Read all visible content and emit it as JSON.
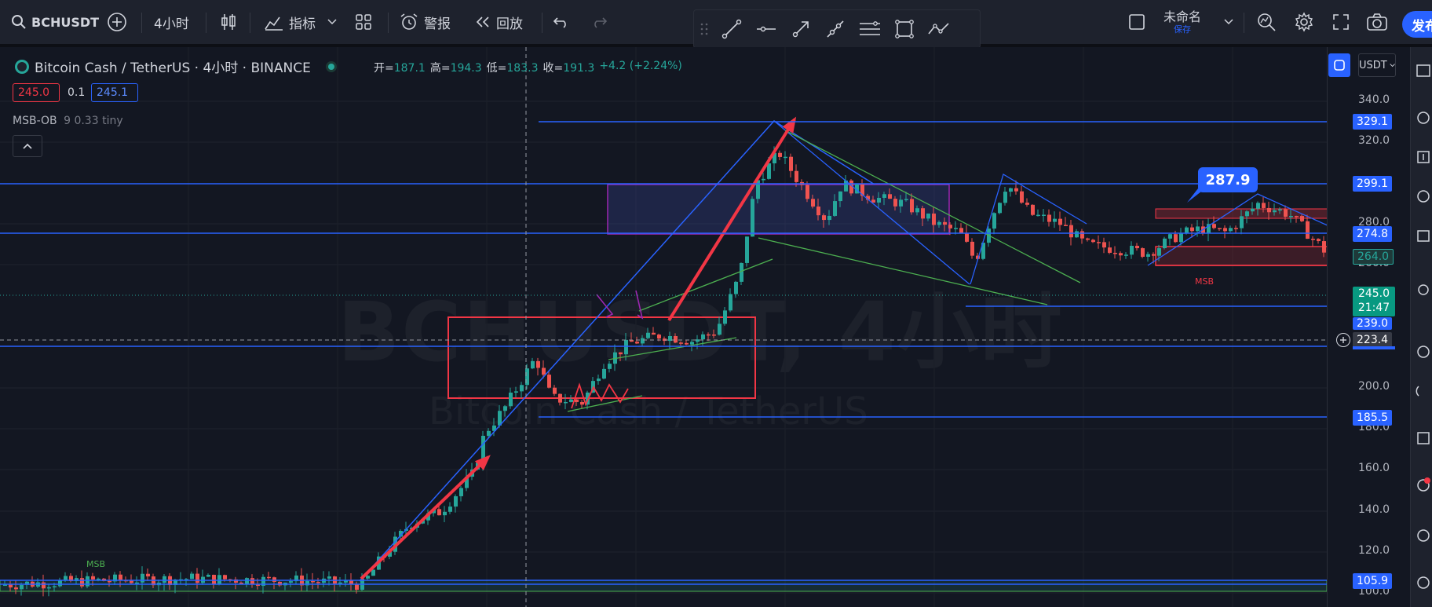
{
  "toolbar": {
    "symbol": "BCHUSDT",
    "interval": "4小时",
    "indicators_label": "指标",
    "alert_label": "警报",
    "replay_label": "回放",
    "layout_name": "未命名",
    "layout_status": "保存",
    "publish_label": "发布"
  },
  "legend": {
    "title": "Bitcoin Cash / TetherUS · 4小时 · BINANCE",
    "open_label": "开=",
    "open": "187.1",
    "high_label": "高=",
    "high": "194.3",
    "low_label": "低=",
    "low": "183.3",
    "close_label": "收=",
    "close": "191.3",
    "change": "+4.2 (+2.24%)",
    "sell_price": "245.0",
    "spread": "0.1",
    "buy_price": "245.1",
    "indicator": "MSB-OB",
    "indicator_params": "9 0.33 tiny"
  },
  "watermark": {
    "symbol_interval": "BCHUSDT, 4小时",
    "name": "Bitcoin Cash / TetherUS"
  },
  "currency": "USDT",
  "price_axis": [
    "340.0",
    "320.0",
    "280.0",
    "260.0",
    "200.0",
    "180.0",
    "160.0",
    "140.0",
    "120.0",
    "100.0"
  ],
  "price_tags": {
    "t329": "329.1",
    "t299": "299.1",
    "t274": "274.8",
    "t264": "264.0",
    "t245": "245.0",
    "countdown": "21:47",
    "t239": "239.0",
    "crosshair": "223.4",
    "t185": "185.5",
    "t105": "105.9"
  },
  "callout_value": "287.9",
  "msb_label": "MSB",
  "colors": {
    "up": "#26a69a",
    "down": "#ef5350",
    "line_blue": "#2962ff",
    "box_red": "#f23645",
    "trend_green": "#4caf50"
  }
}
